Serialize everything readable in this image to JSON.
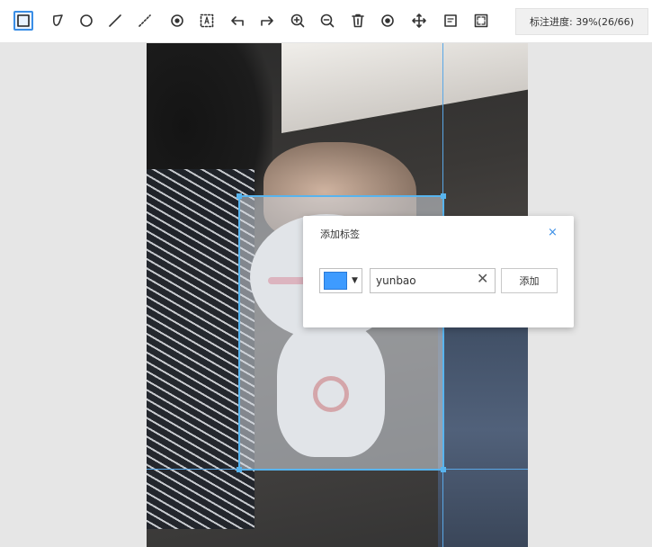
{
  "toolbar": {
    "tools": [
      {
        "name": "rectangle-tool",
        "icon": "square-icon",
        "active": true
      },
      {
        "name": "polygon-tool",
        "icon": "polygon-icon"
      },
      {
        "name": "circle-tool",
        "icon": "circle-icon"
      },
      {
        "name": "line-tool",
        "icon": "line-icon"
      },
      {
        "name": "dashed-line-tool",
        "icon": "dashed-line-icon"
      },
      {
        "name": "point-tool",
        "icon": "target-point-icon"
      },
      {
        "name": "text-tool",
        "icon": "text-box-icon"
      },
      {
        "name": "undo-tool",
        "icon": "undo-arrow-icon"
      },
      {
        "name": "redo-tool",
        "icon": "redo-arrow-icon"
      },
      {
        "name": "zoom-in-tool",
        "icon": "zoom-in-icon"
      },
      {
        "name": "zoom-out-tool",
        "icon": "zoom-out-icon"
      },
      {
        "name": "delete-tool",
        "icon": "trash-icon"
      },
      {
        "name": "visibility-tool",
        "icon": "eye-icon"
      },
      {
        "name": "move-tool",
        "icon": "move-icon"
      },
      {
        "name": "label-tool",
        "icon": "label-box-icon"
      },
      {
        "name": "fullscreen-tool",
        "icon": "fullscreen-icon"
      }
    ],
    "progress_text": "标注进度: 39%(26/66)"
  },
  "dialog": {
    "title": "添加标签",
    "close_symbol": "×",
    "selected_color": "#3e9bff",
    "caret": "▼",
    "input_value": "yunbao",
    "clear_symbol": "✕",
    "add_label": "添加"
  },
  "colors": {
    "accent": "#3a8ee6",
    "bbox": "#58b4ee"
  }
}
